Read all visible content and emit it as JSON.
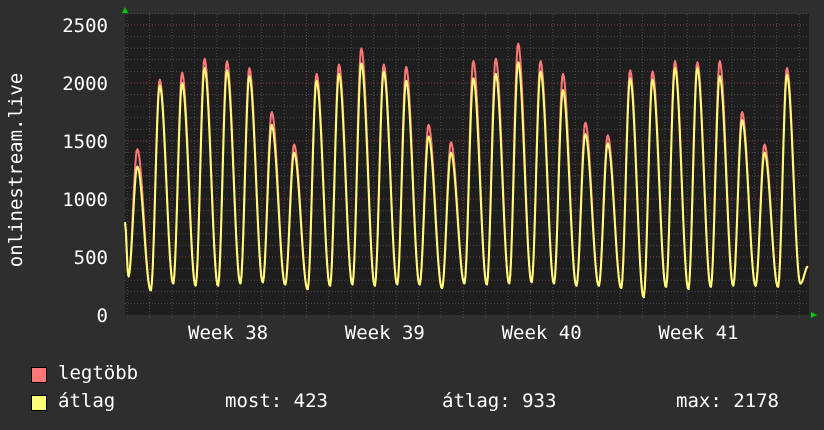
{
  "chart_data": {
    "type": "line",
    "ylabel": "onlinestream.live",
    "ylim": [
      0,
      2600
    ],
    "yticks": [
      0,
      500,
      1000,
      1500,
      2000,
      2500
    ],
    "ytick_labels": [
      "0",
      "500",
      "1000",
      "1500",
      "2000",
      "2500"
    ],
    "x_unit": "days",
    "xlim": [
      0,
      30.5
    ],
    "week_boundaries": [
      1.1,
      8.1,
      15.1,
      22.1,
      29.1
    ],
    "xtick_labels": [
      {
        "label": "Week 38",
        "day": 4.6
      },
      {
        "label": "Week 39",
        "day": 11.6
      },
      {
        "label": "Week 40",
        "day": 18.6
      },
      {
        "label": "Week 41",
        "day": 25.6
      }
    ],
    "grid": true,
    "series": [
      {
        "name": "legtöbb",
        "color": "#ff7777",
        "daily_peaks": [
          1430,
          2030,
          2090,
          2210,
          2190,
          2130,
          1750,
          1470,
          2080,
          2160,
          2300,
          2160,
          2140,
          1640,
          1490,
          2190,
          2210,
          2340,
          2190,
          2080,
          1660,
          1550,
          2110,
          2100,
          2190,
          2180,
          2190,
          1750,
          1470,
          2130
        ]
      },
      {
        "name": "átlag",
        "color": "#ffff77",
        "daily_peaks": [
          1280,
          1980,
          2000,
          2130,
          2110,
          2060,
          1640,
          1400,
          2020,
          2080,
          2170,
          2100,
          2020,
          1540,
          1400,
          2040,
          2080,
          2180,
          2100,
          1940,
          1560,
          1480,
          2040,
          2030,
          2130,
          2130,
          2060,
          1680,
          1400,
          2070
        ]
      }
    ],
    "daily_troughs": [
      330,
      210,
      270,
      250,
      250,
      270,
      280,
      260,
      220,
      250,
      260,
      250,
      260,
      260,
      230,
      270,
      260,
      270,
      280,
      270,
      250,
      250,
      230,
      150,
      240,
      220,
      240,
      250,
      250,
      240,
      270
    ],
    "start_value": 800,
    "end_value": 423
  },
  "legend": {
    "max_label": "legtöbb",
    "avg_label": "átlag",
    "now": "most: 423",
    "average": "átlag: 933",
    "maximum": "max: 2178"
  }
}
